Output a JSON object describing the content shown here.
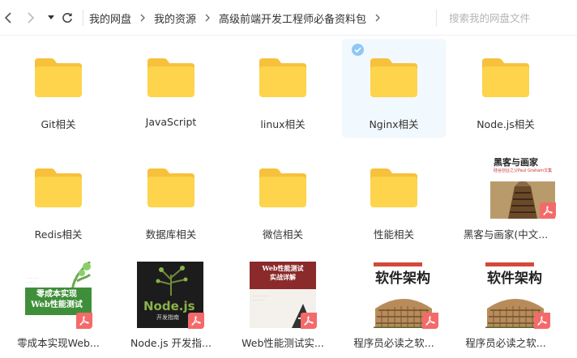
{
  "toolbar": {
    "back_icon": "chevron-left-icon",
    "forward_icon": "chevron-right-icon",
    "history_icon": "caret-down-icon",
    "refresh_icon": "refresh-icon",
    "breadcrumbs": [
      "我的网盘",
      "我的资源",
      "高级前端开发工程师必备资料包"
    ],
    "search_placeholder": "搜索我的网盘文件"
  },
  "colors": {
    "folder": "#fdd44c",
    "folder_tab": "#f7c13c",
    "selected_bg": "#f1f8fe",
    "check": "#8fc7f5",
    "pdf_badge": "#f46a6a"
  },
  "items": [
    {
      "label": "Git相关",
      "type": "folder"
    },
    {
      "label": "JavaScript",
      "type": "folder"
    },
    {
      "label": "linux相关",
      "type": "folder"
    },
    {
      "label": "Nginx相关",
      "type": "folder",
      "selected": true
    },
    {
      "label": "Node.js相关",
      "type": "folder"
    },
    {
      "label": "Redis相关",
      "type": "folder"
    },
    {
      "label": "数据库相关",
      "type": "folder"
    },
    {
      "label": "微信相关",
      "type": "folder"
    },
    {
      "label": "性能相关",
      "type": "folder"
    },
    {
      "label": "黑客与画家(中文...",
      "type": "pdf",
      "cover_title": "黑客与画家",
      "cover_subtitle": "硅谷创业之父Paul Graham文集"
    },
    {
      "label": "零成本实现Web...",
      "type": "pdf",
      "cover_title": "零成本实现\nWeb性能测试"
    },
    {
      "label": "Node.js 开发指...",
      "type": "pdf",
      "cover_title": "Node.js",
      "cover_subtitle": "开发指南"
    },
    {
      "label": "Web性能测试实...",
      "type": "pdf",
      "cover_title": "Web性能测试\n实战详解"
    },
    {
      "label": "程序员必读之软...",
      "type": "pdf",
      "cover_title": "软件架构"
    },
    {
      "label": "程序员必读之软...",
      "type": "pdf",
      "cover_title": "软件架构"
    }
  ]
}
